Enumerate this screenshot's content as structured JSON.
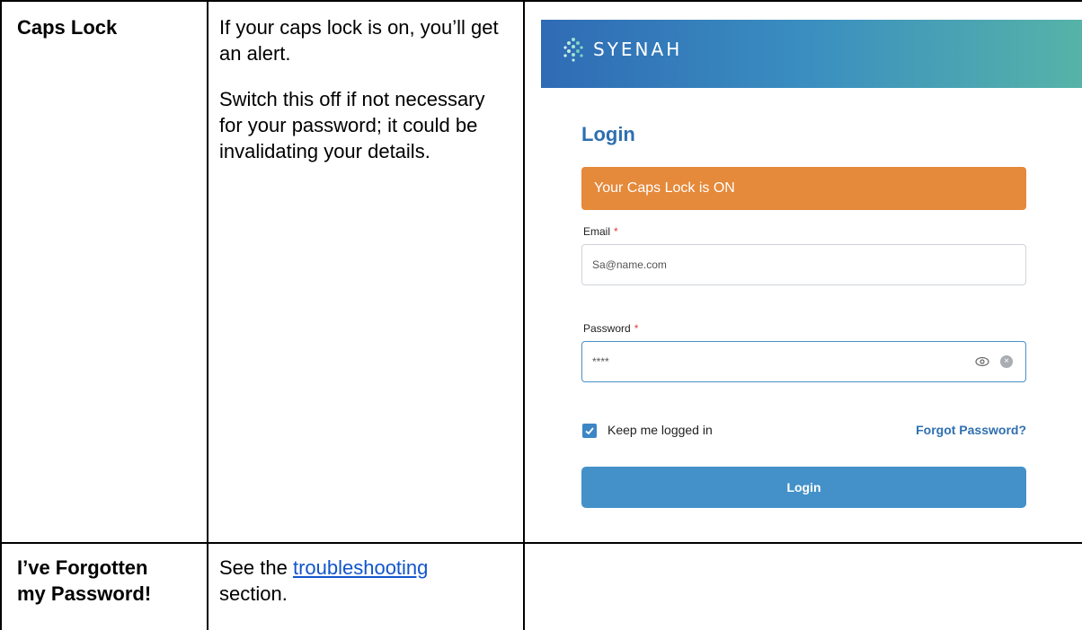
{
  "rows": [
    {
      "term": "Caps Lock",
      "desc_1": "If your caps lock is on, you’ll get an alert.",
      "desc_2": "Switch this off if not necessary for your password; it could be invalidating your details."
    },
    {
      "term_line1": "I’ve Forgotten",
      "term_line2": "my Password!",
      "desc_before": "See the ",
      "link": "troubleshooting",
      "desc_after": " section."
    }
  ],
  "login_screen": {
    "logo_text": "SYENAH",
    "title": "Login",
    "alert": "Your Caps Lock is ON",
    "email_label": "Email",
    "email_value": "Sa@name.com",
    "password_label": "Password",
    "password_value": "****",
    "required_mark": "*",
    "keep_logged_in": "Keep me logged in",
    "keep_logged_in_checked": true,
    "forgot": "Forgot Password?",
    "login_button": "Login",
    "icons": [
      "eye-icon",
      "clear-icon",
      "check-icon",
      "logo-icon"
    ],
    "colors": {
      "alert": "#e5893a",
      "button": "#4491c9",
      "title": "#2e6fb0",
      "banner_start": "#2f6bb5",
      "banner_end": "#56b3a8"
    }
  }
}
